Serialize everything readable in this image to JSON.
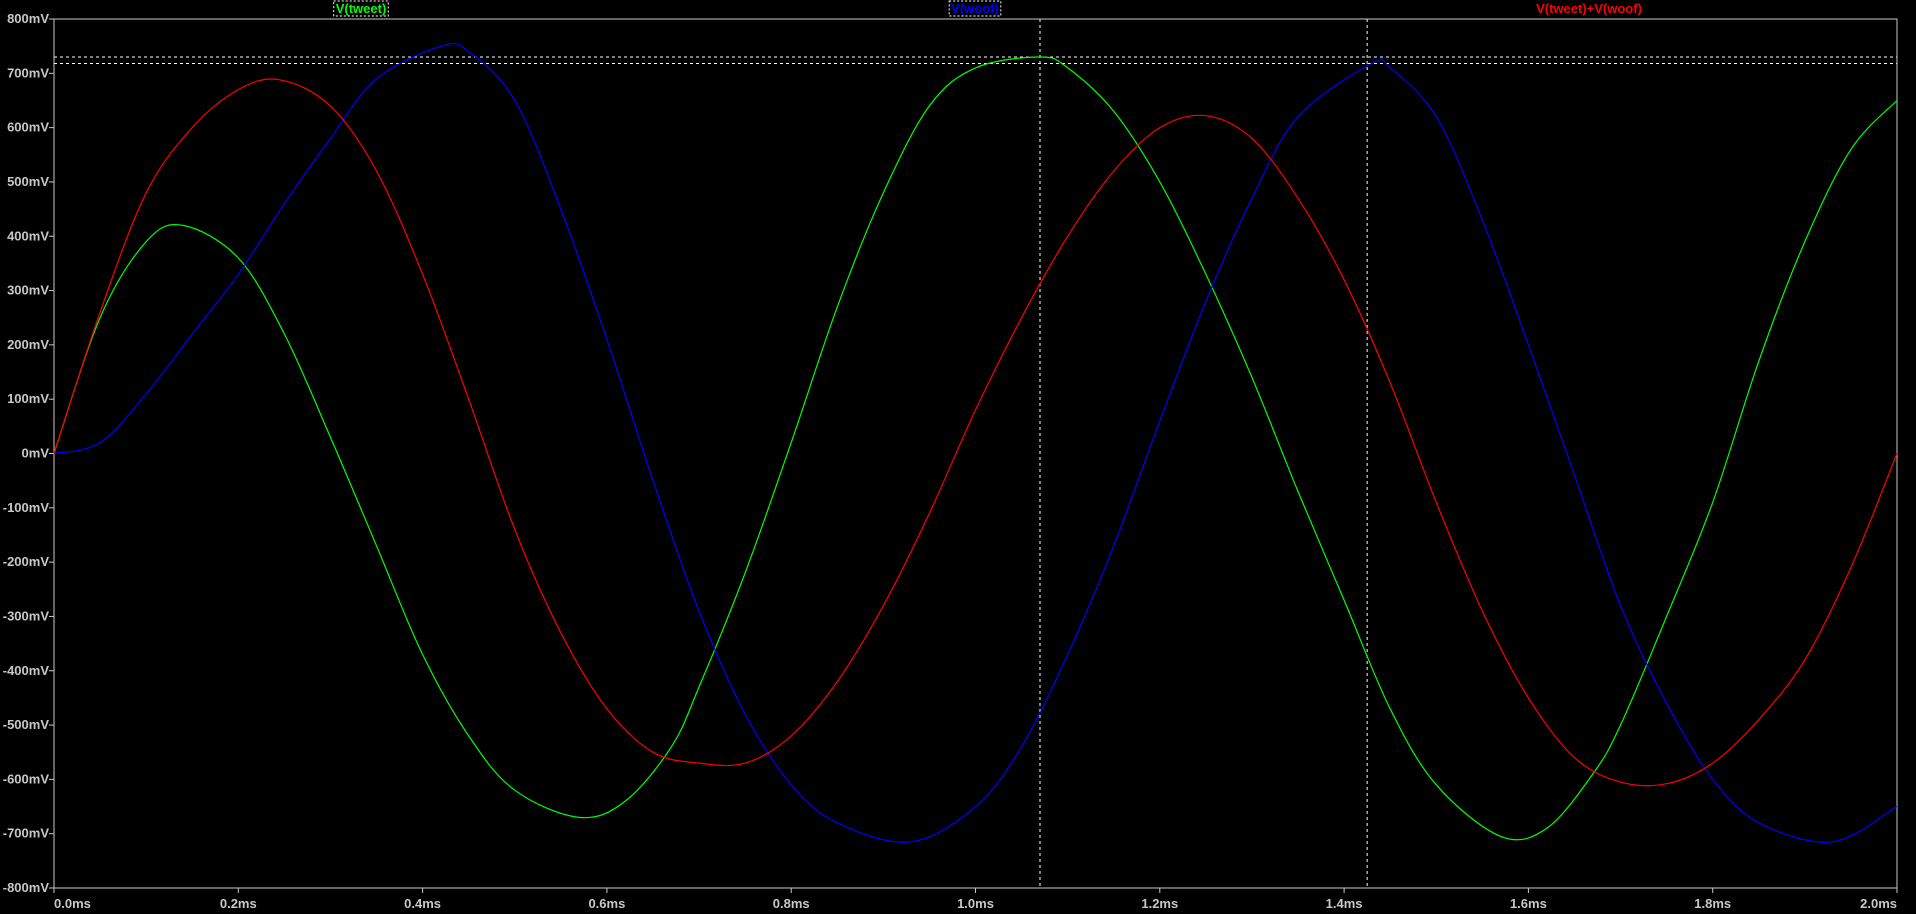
{
  "chart_data": {
    "type": "line",
    "xlabel": "",
    "ylabel": "",
    "xlim": [
      0,
      2.0
    ],
    "ylim": [
      -800,
      800
    ],
    "x_unit": "ms",
    "y_unit": "mV",
    "x_ticks": [
      "0.0ms",
      "0.2ms",
      "0.4ms",
      "0.6ms",
      "0.8ms",
      "1.0ms",
      "1.2ms",
      "1.4ms",
      "1.6ms",
      "1.8ms",
      "2.0ms"
    ],
    "y_ticks": [
      "800mV",
      "700mV",
      "600mV",
      "500mV",
      "400mV",
      "300mV",
      "200mV",
      "100mV",
      "0mV",
      "-100mV",
      "-200mV",
      "-300mV",
      "-400mV",
      "-500mV",
      "-600mV",
      "-700mV",
      "-800mV"
    ],
    "grid": false,
    "legend_position": "top",
    "cursors": {
      "x": [
        1.07,
        1.425
      ],
      "y": [
        730,
        718
      ]
    },
    "series": [
      {
        "name": "V(tweet)",
        "color": "#00ff00",
        "x": [
          0.0,
          0.05,
          0.1,
          0.14,
          0.2,
          0.25,
          0.3,
          0.35,
          0.4,
          0.45,
          0.5,
          0.57,
          0.62,
          0.67,
          0.7,
          0.75,
          0.8,
          0.85,
          0.9,
          0.95,
          1.0,
          1.07,
          1.1,
          1.15,
          1.2,
          1.25,
          1.3,
          1.35,
          1.4,
          1.45,
          1.5,
          1.57,
          1.62,
          1.67,
          1.7,
          1.75,
          1.8,
          1.85,
          1.9,
          1.95,
          2.0
        ],
        "values": [
          0,
          250,
          390,
          420,
          360,
          220,
          30,
          -170,
          -370,
          -520,
          -620,
          -670,
          -640,
          -540,
          -430,
          -220,
          20,
          270,
          480,
          640,
          710,
          730,
          710,
          630,
          500,
          330,
          140,
          -70,
          -270,
          -470,
          -610,
          -705,
          -690,
          -590,
          -500,
          -300,
          -90,
          170,
          390,
          560,
          650
        ]
      },
      {
        "name": "V(woof)",
        "color": "#0000ff",
        "x": [
          0.0,
          0.05,
          0.1,
          0.15,
          0.2,
          0.25,
          0.3,
          0.35,
          0.42,
          0.45,
          0.5,
          0.55,
          0.6,
          0.65,
          0.7,
          0.75,
          0.8,
          0.85,
          0.93,
          1.0,
          1.05,
          1.1,
          1.15,
          1.2,
          1.25,
          1.3,
          1.35,
          1.43,
          1.45,
          1.5,
          1.55,
          1.6,
          1.65,
          1.7,
          1.75,
          1.8,
          1.85,
          1.93,
          2.0
        ],
        "values": [
          0,
          20,
          110,
          220,
          330,
          460,
          580,
          690,
          750,
          740,
          650,
          450,
          210,
          -50,
          -290,
          -480,
          -610,
          -680,
          -715,
          -650,
          -540,
          -370,
          -170,
          60,
          280,
          470,
          620,
          718,
          710,
          620,
          430,
          200,
          -40,
          -280,
          -460,
          -600,
          -680,
          -715,
          -650
        ]
      },
      {
        "name": "V(tweet)+V(woof)",
        "color": "#ff0000",
        "x": [
          0.0,
          0.05,
          0.1,
          0.15,
          0.2,
          0.245,
          0.3,
          0.35,
          0.4,
          0.45,
          0.5,
          0.55,
          0.6,
          0.65,
          0.7,
          0.75,
          0.8,
          0.85,
          0.9,
          0.95,
          1.0,
          1.05,
          1.1,
          1.15,
          1.2,
          1.25,
          1.3,
          1.35,
          1.4,
          1.45,
          1.5,
          1.55,
          1.6,
          1.65,
          1.7,
          1.75,
          1.8,
          1.85,
          1.9,
          1.95,
          2.0
        ],
        "values": [
          0,
          260,
          480,
          600,
          670,
          688,
          640,
          520,
          330,
          100,
          -140,
          -330,
          -470,
          -550,
          -570,
          -570,
          -520,
          -420,
          -280,
          -110,
          80,
          250,
          400,
          520,
          600,
          622,
          580,
          470,
          320,
          130,
          -90,
          -290,
          -450,
          -560,
          -605,
          -608,
          -570,
          -490,
          -380,
          -210,
          0
        ]
      }
    ]
  }
}
